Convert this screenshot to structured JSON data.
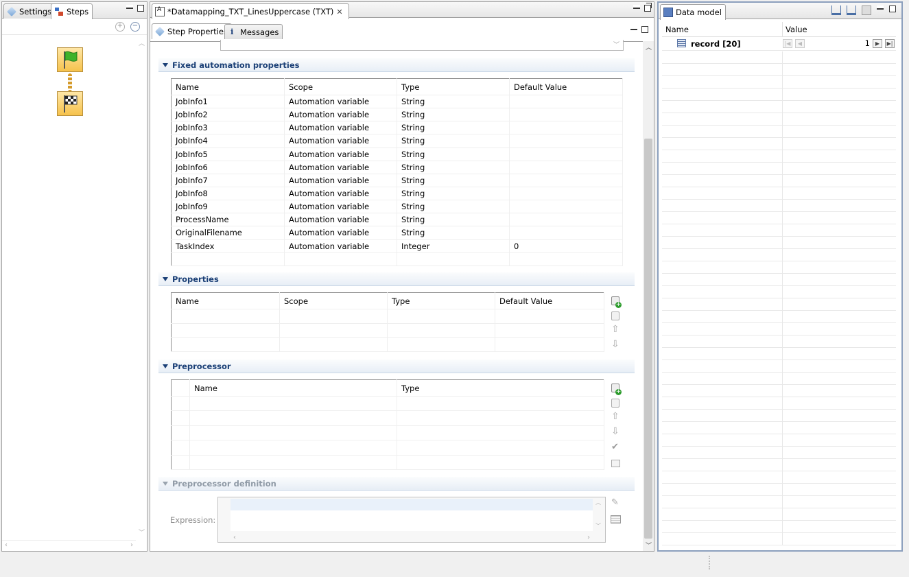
{
  "left": {
    "tabs": [
      {
        "label": "Settings"
      },
      {
        "label": "Steps"
      }
    ]
  },
  "editor": {
    "tab_title": "*Datamapping_TXT_LinesUppercase (TXT)",
    "sub_tabs": [
      {
        "label": "Step Properties"
      },
      {
        "label": "Messages"
      }
    ],
    "fixed": {
      "title": "Fixed automation properties",
      "columns": [
        "Name",
        "Scope",
        "Type",
        "Default Value"
      ],
      "rows": [
        [
          "JobInfo1",
          "Automation variable",
          "String",
          ""
        ],
        [
          "JobInfo2",
          "Automation variable",
          "String",
          ""
        ],
        [
          "JobInfo3",
          "Automation variable",
          "String",
          ""
        ],
        [
          "JobInfo4",
          "Automation variable",
          "String",
          ""
        ],
        [
          "JobInfo5",
          "Automation variable",
          "String",
          ""
        ],
        [
          "JobInfo6",
          "Automation variable",
          "String",
          ""
        ],
        [
          "JobInfo7",
          "Automation variable",
          "String",
          ""
        ],
        [
          "JobInfo8",
          "Automation variable",
          "String",
          ""
        ],
        [
          "JobInfo9",
          "Automation variable",
          "String",
          ""
        ],
        [
          "ProcessName",
          "Automation variable",
          "String",
          ""
        ],
        [
          "OriginalFilename",
          "Automation variable",
          "String",
          ""
        ],
        [
          "TaskIndex",
          "Automation variable",
          "Integer",
          "0"
        ]
      ]
    },
    "properties": {
      "title": "Properties",
      "columns": [
        "Name",
        "Scope",
        "Type",
        "Default Value"
      ]
    },
    "preprocessor": {
      "title": "Preprocessor",
      "columns": [
        "Name",
        "Type"
      ]
    },
    "preprocessor_def": {
      "title": "Preprocessor definition",
      "expression_label": "Expression:"
    }
  },
  "data_model": {
    "tab_title": "Data model",
    "columns": [
      "Name",
      "Value"
    ],
    "record_label": "record [20]",
    "record_index": "1"
  }
}
